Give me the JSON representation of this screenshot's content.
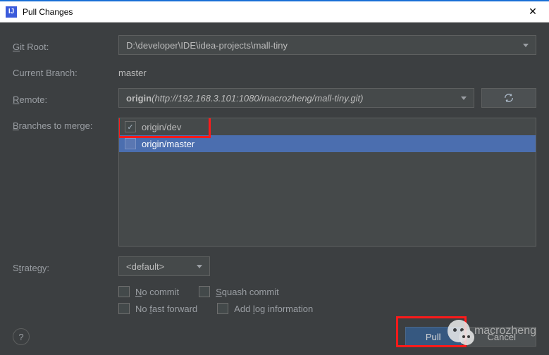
{
  "window": {
    "title": "Pull Changes",
    "app_icon_letter": "IJ"
  },
  "form": {
    "git_root_label": "Git Root:",
    "git_root_value": "D:\\developer\\IDE\\idea-projects\\mall-tiny",
    "current_branch_label": "Current Branch:",
    "current_branch_value": "master",
    "remote_label": "Remote:",
    "remote_name": "origin",
    "remote_url": "(http://192.168.3.101:1080/macrozheng/mall-tiny.git)",
    "branches_label": "Branches to merge:",
    "branches": [
      {
        "label": "origin/dev",
        "checked": true,
        "selected": false
      },
      {
        "label": "origin/master",
        "checked": false,
        "selected": true
      }
    ],
    "strategy_label": "Strategy:",
    "strategy_value": "<default>",
    "options": {
      "no_commit": "No commit",
      "no_ff": "No fast forward",
      "squash": "Squash commit",
      "add_log": "Add log information"
    }
  },
  "buttons": {
    "pull": "Pull",
    "cancel": "Cancel",
    "help": "?"
  },
  "watermark": "macrozheng"
}
